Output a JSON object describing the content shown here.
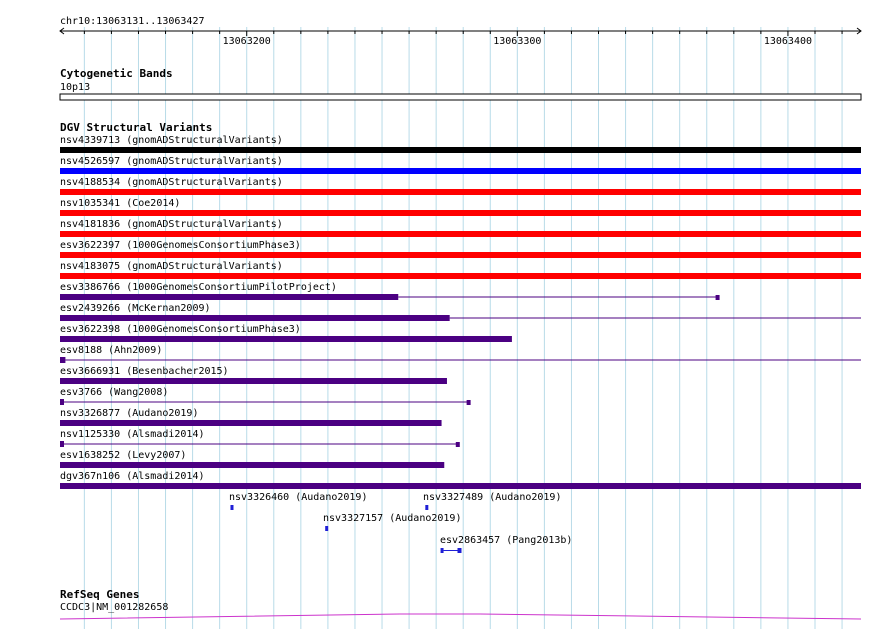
{
  "colors": {
    "grid": "#b8dbe8",
    "text": "#000000",
    "cnv_black": "#000000",
    "cnv_blue": "#0000ff",
    "cnv_red": "#ff0000",
    "cnv_purple": "#4b0082",
    "small_blue": "#1f1fd6",
    "refseq": "#cc33cc"
  },
  "ruler": {
    "location": "chr10:13063131..13063427",
    "ticks": [
      {
        "label": "13063200",
        "pos": 13063200
      },
      {
        "label": "13063300",
        "pos": 13063300
      },
      {
        "label": "13063400",
        "pos": 13063400
      }
    ]
  },
  "cytoband": {
    "title": "Cytogenetic Bands",
    "band": "10p13"
  },
  "dgv": {
    "title": "DGV Structural Variants",
    "tracks": [
      {
        "label": "nsv4339713 (gnomADStructuralVariants)",
        "color": "black",
        "style": "full"
      },
      {
        "label": "nsv4526597 (gnomADStructuralVariants)",
        "color": "blue",
        "style": "full"
      },
      {
        "label": "nsv4188534 (gnomADStructuralVariants)",
        "color": "red",
        "style": "full"
      },
      {
        "label": "nsv1035341 (Coe2014)",
        "color": "red",
        "style": "full"
      },
      {
        "label": "nsv4181836 (gnomADStructuralVariants)",
        "color": "red",
        "style": "full"
      },
      {
        "label": "esv3622397 (1000GenomesConsortiumPhase3)",
        "color": "red",
        "style": "full"
      },
      {
        "label": "nsv4183075 (gnomADStructuralVariants)",
        "color": "red",
        "style": "full"
      },
      {
        "label": "esv3386766 (1000GenomesConsortiumPilotProject)",
        "color": "purple",
        "style": "split",
        "thick_end": 13063256,
        "line_end": 13063374,
        "end_cap": true
      },
      {
        "label": "esv2439266 (McKernan2009)",
        "color": "purple",
        "style": "split",
        "thick_end": 13063275,
        "line_end": 13063427,
        "end_cap": false
      },
      {
        "label": "esv3622398 (1000GenomesConsortiumPhase3)",
        "color": "purple",
        "style": "split",
        "thick_end": 13063298,
        "line_end": 13063298,
        "end_cap": false
      },
      {
        "label": "esv8188 (Ahn2009)",
        "color": "purple",
        "style": "split",
        "thick_end": 13063133,
        "line_end": 13063427,
        "end_cap": false
      },
      {
        "label": "esv3666931 (Besenbacher2015)",
        "color": "purple",
        "style": "split",
        "thick_end": 13063274,
        "line_end": 13063274,
        "end_cap": false
      },
      {
        "label": "esv3766 (Wang2008)",
        "color": "purple",
        "style": "split",
        "thick_end": 13063131,
        "line_end": 13063282,
        "end_cap": true
      },
      {
        "label": "nsv3326877 (Audano2019)",
        "color": "purple",
        "style": "split",
        "thick_end": 13063272,
        "line_end": 13063272,
        "end_cap": false
      },
      {
        "label": "nsv1125330 (Alsmadi2014)",
        "color": "purple",
        "style": "split",
        "thick_end": 13063131,
        "line_end": 13063278,
        "end_cap": true
      },
      {
        "label": "esv1638252 (Levy2007)",
        "color": "purple",
        "style": "split",
        "thick_end": 13063273,
        "line_end": 13063273,
        "end_cap": false
      },
      {
        "label": "dgv367n106 (Alsmadi2014)",
        "color": "purple",
        "style": "full"
      }
    ],
    "small": [
      {
        "label": "nsv3326460 (Audano2019)",
        "start": 13063194,
        "end": 13063195
      },
      {
        "label": "nsv3327489 (Audano2019)",
        "start": 13063266,
        "end": 13063267
      },
      {
        "label": "nsv3327157 (Audano2019)",
        "start": 13063229,
        "end": 13063230
      },
      {
        "label": "esv2863457 (Pang2013b)",
        "start": 13063272,
        "end": 13063279,
        "gapped": true
      }
    ]
  },
  "refseq": {
    "title": "RefSeq Genes",
    "gene": "CCDC3|NM_001282658"
  }
}
